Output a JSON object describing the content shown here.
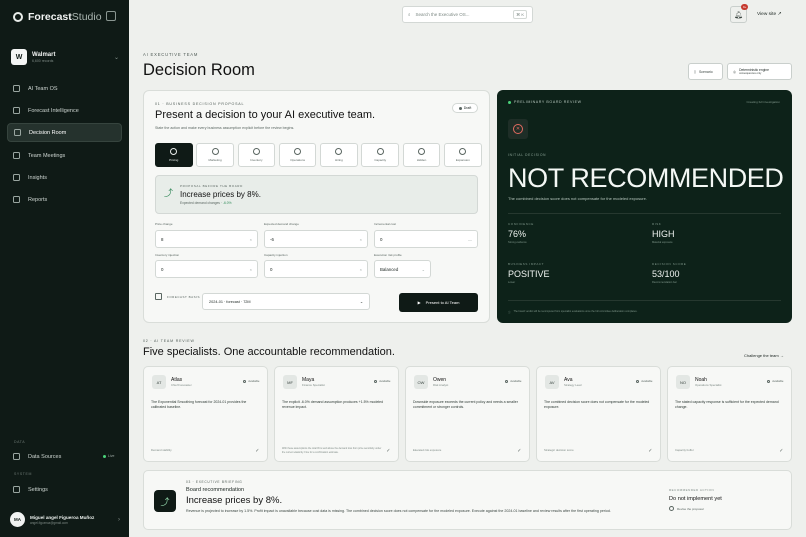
{
  "app": {
    "brand": "Forecast",
    "brand_suffix": "Studio"
  },
  "org": {
    "avatar": "W",
    "name": "Walmart",
    "sub": "6,600 records"
  },
  "nav": [
    {
      "label": "AI Team OS"
    },
    {
      "label": "Forecast Intelligence"
    },
    {
      "label": "Decision Room"
    },
    {
      "label": "Team Meetings"
    },
    {
      "label": "Insights"
    },
    {
      "label": "Reports"
    }
  ],
  "sidebar": {
    "data_label": "DATA",
    "data_sources": "Data Sources",
    "live": "Live",
    "system_label": "SYSTEM",
    "settings": "Settings"
  },
  "user": {
    "initials": "MA",
    "name": "Miguel angel Figueroa Muñoz",
    "email": "angel.figueroa@gmail.com"
  },
  "topbar": {
    "search_placeholder": "Search the Executive OS...",
    "shortcut": "⌘ K",
    "bell_badge": "9+",
    "view_site": "View site"
  },
  "header": {
    "crumb": "AI EXECUTIVE TEAM",
    "title": "Decision Room",
    "btn_history": "Scenario",
    "btn_engine": "Deterministic engine",
    "btn_engine_sub": "consequences only"
  },
  "proposal_card": {
    "kicker": "01 · BUSINESS DECISION PROPOSAL",
    "status": "Draft",
    "heading": "Present a decision to your AI executive team.",
    "sub": "State the action and make every business assumption explicit before the review begins.",
    "levers": [
      "Pricing",
      "Marketing",
      "Inventory",
      "Operations",
      "Hiring",
      "Capacity",
      "Hidden",
      "Expansion"
    ],
    "proposal_kicker": "PROPOSAL BEFORE THE BOARD",
    "proposal_title": "Increase prices by 8%.",
    "proposal_sub": "Expected demand changes",
    "proposal_delta": "-6.0%",
    "fields": [
      {
        "label": "Price change",
        "value": "8"
      },
      {
        "label": "Expected demand change",
        "value": "-6"
      },
      {
        "label": "Incremental cost",
        "value": "0"
      },
      {
        "label": "Inventory injection",
        "value": "0"
      },
      {
        "label": "Capacity injection",
        "value": "0"
      },
      {
        "label": "Execution risk profile",
        "value": "Balanced"
      }
    ],
    "snapshot_label": "FORECAST BASIS",
    "snapshot_value": "2024-01 · forecast · 72M",
    "present_btn": "Present to AI Team"
  },
  "review": {
    "kicker": "PRELIMINARY BOARD REVIEW",
    "top_right": "Creating full investigation",
    "label": "INITIAL DECISION",
    "verdict": "NOT RECOMMENDED",
    "summary": "The combined decision score does not compensate for the modeled exposure.",
    "metrics": [
      {
        "key": "CONFIDENCE",
        "value": "76%",
        "sub": "Strong evidence"
      },
      {
        "key": "RISK",
        "value": "HIGH",
        "sub": "Material exposure"
      },
      {
        "key": "BUSINESS IMPACT",
        "value": "POSITIVE",
        "sub": "Lower"
      },
      {
        "key": "DECISION SCORE",
        "value": "53/100",
        "sub": "Recommendation bar"
      }
    ],
    "footer": "The board verdict will be recomputed from specialist evaluations once the full committee deliberation completes."
  },
  "specialists": {
    "kicker": "02 · AI TEAM REVIEW",
    "heading": "Five specialists. One accountable recommendation.",
    "challenge": "Challenge the team",
    "items": [
      {
        "initials": "AT",
        "name": "Atlas",
        "role": "Chief Forecaster",
        "status": "Available",
        "text": "The Exponential Smoothing forecast for 2024-01 provides the calibrated baseline.",
        "foot": "Demand stability"
      },
      {
        "initials": "MF",
        "name": "Maya",
        "role": "Finance Specialist",
        "status": "Available",
        "text": "The explicit -6.0% demand assumption produces +1.5% modeled revenue impact.",
        "foot": "With these assumptions the total lift is well above the demand loss from price sensitivity under the current elasticity. Fine for a confirmation estimate."
      },
      {
        "initials": "OW",
        "name": "Owen",
        "role": "Risk Analyst",
        "status": "Available",
        "text": "Downside exposure exceeds the current policy and needs a smaller commitment or stronger controls.",
        "foot": "Elevated risk exposure"
      },
      {
        "initials": "AV",
        "name": "Ava",
        "role": "Strategy Lead",
        "status": "Available",
        "text": "The combined decision score does not compensate for the modeled exposure.",
        "foot": "Strategic decision score"
      },
      {
        "initials": "NO",
        "name": "Noah",
        "role": "Operations Specialist",
        "status": "Available",
        "text": "The stated capacity response is sufficient for the expected demand change.",
        "foot": "Capacity buffer"
      }
    ]
  },
  "briefing": {
    "kicker": "03 · EXECUTIVE BRIEFING",
    "sub": "Board recommendation",
    "heading": "Increase prices by 8%.",
    "body": "Revenue is projected to increase by 1.5%. Profit impact is unavailable because cost data is missing. The combined decision score does not compensate for the modeled exposure. Execute against the 2024-01 baseline and review results after the first operating period.",
    "right_kicker": "RECOMMENDED ACTION",
    "right_value": "Do not implement yet",
    "right_sub": "Revise the proposal"
  }
}
